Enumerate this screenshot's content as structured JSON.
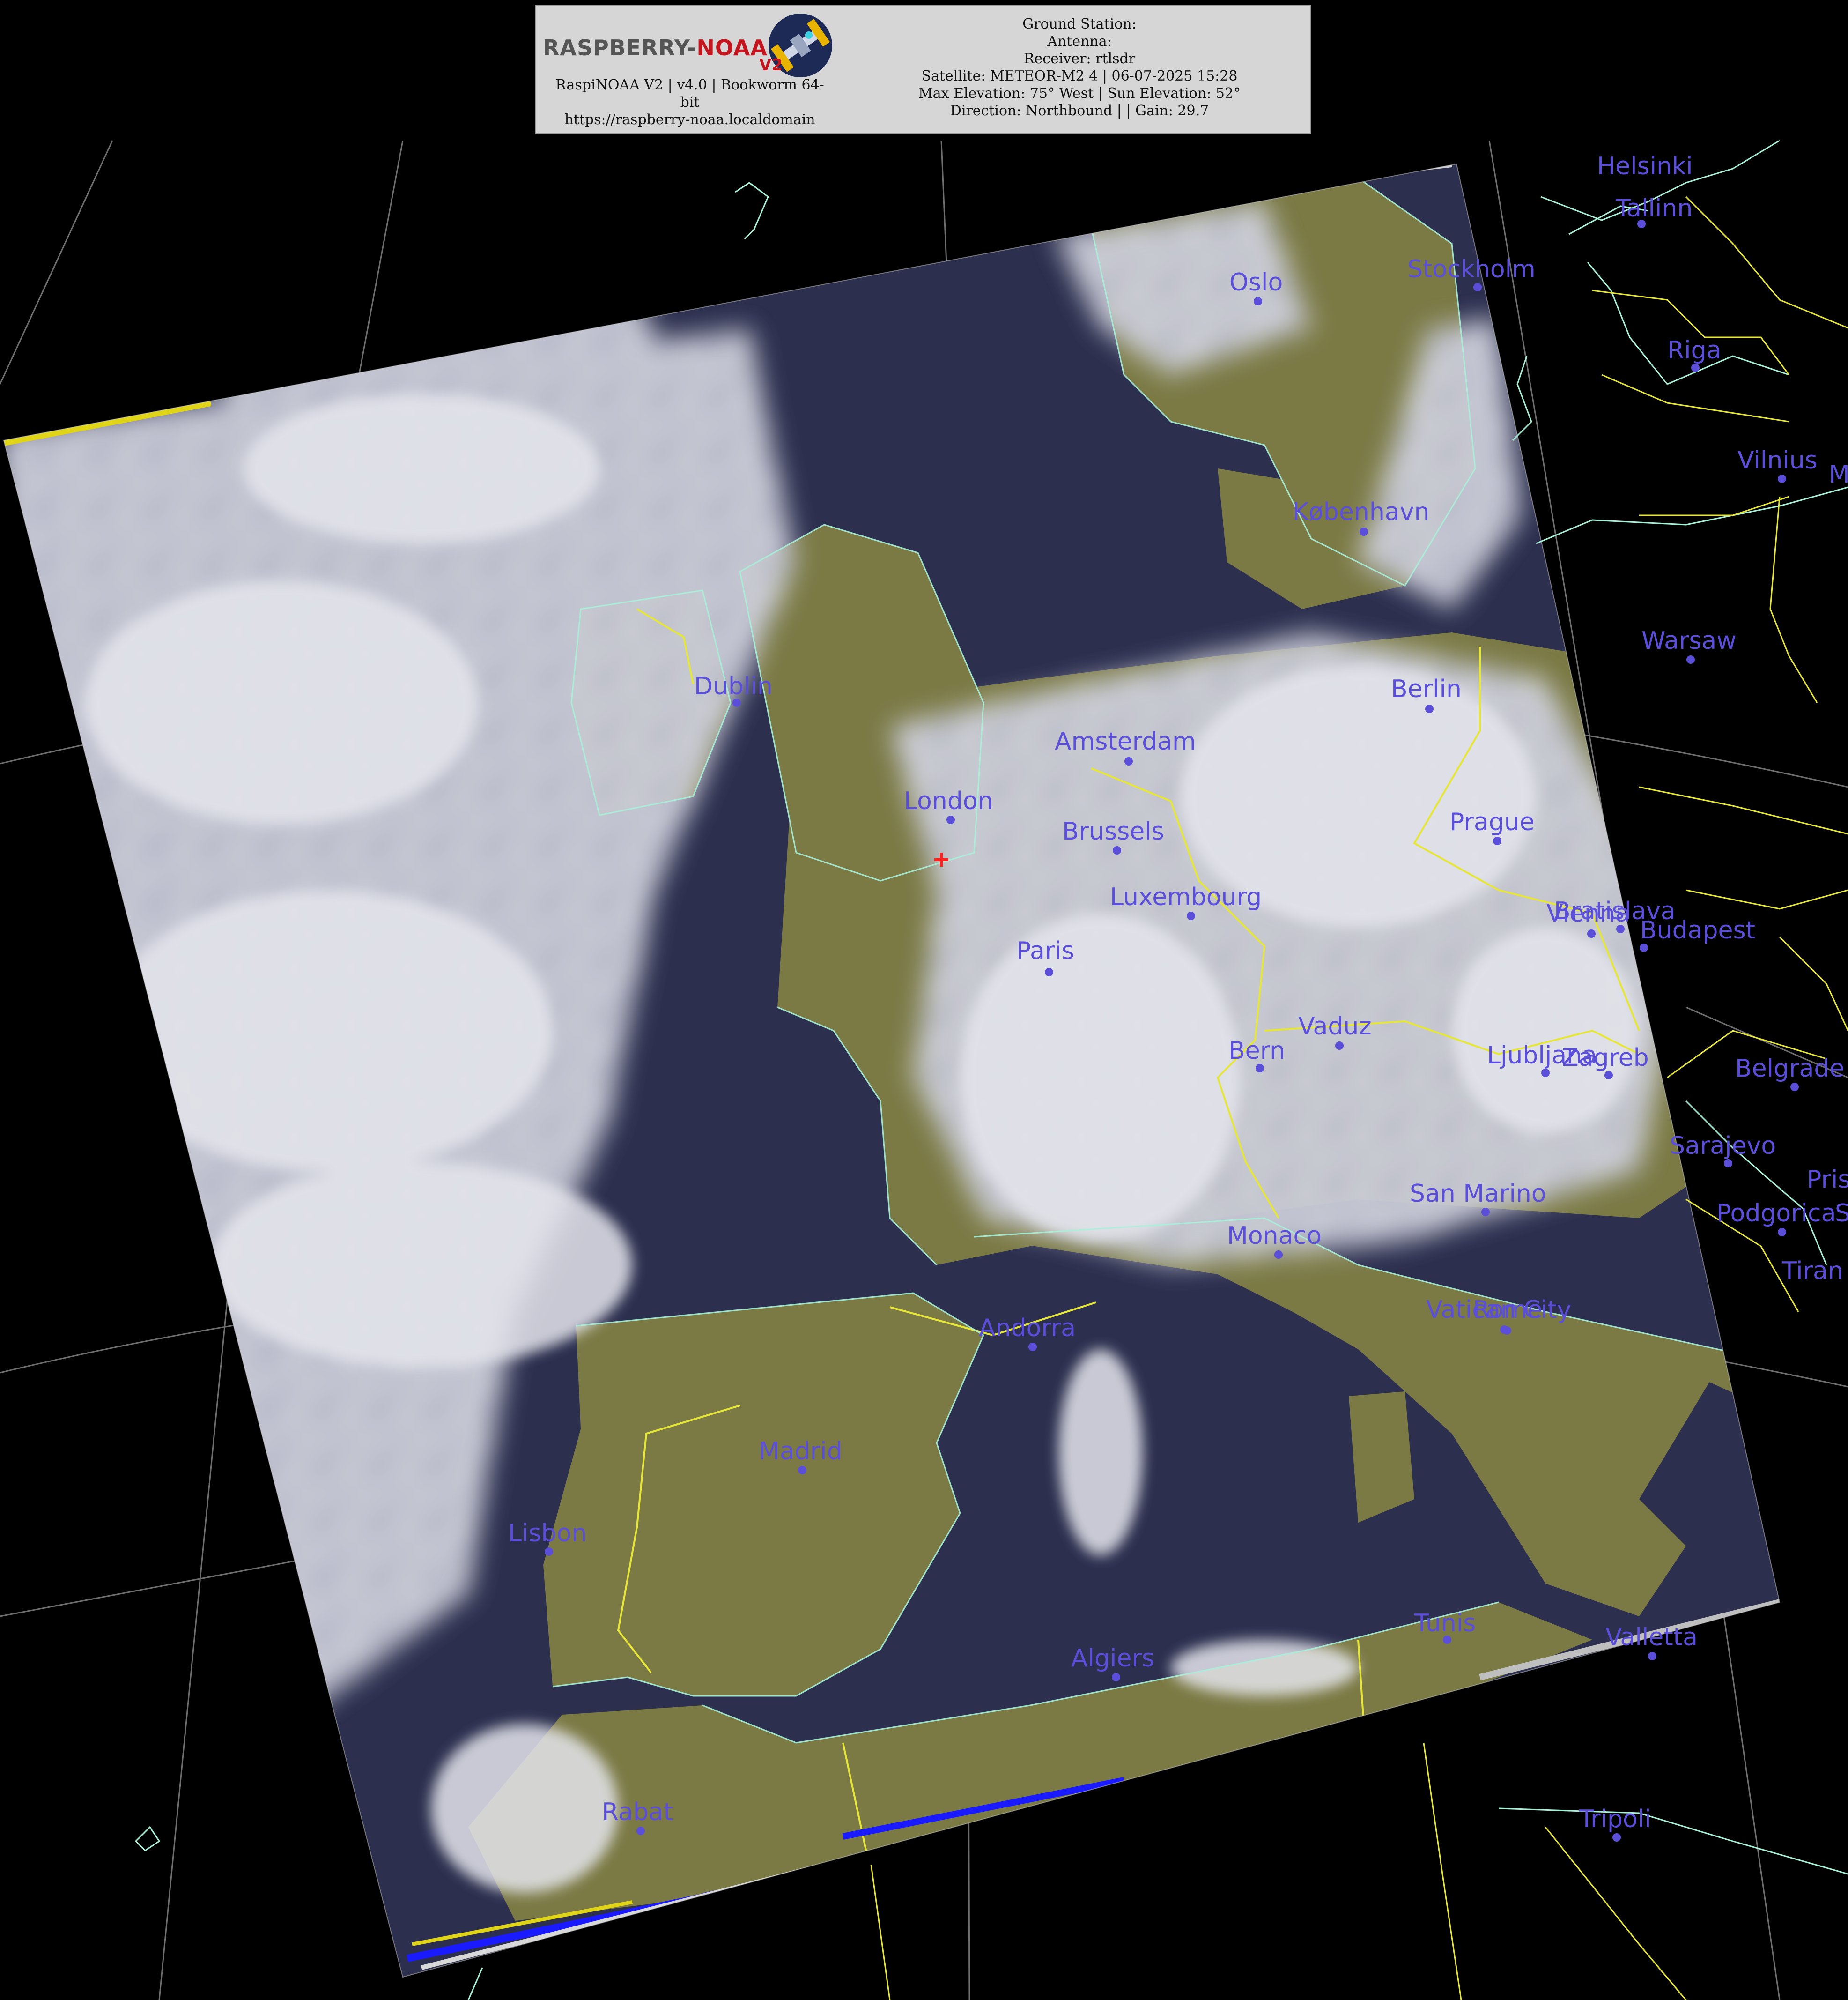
{
  "header": {
    "logo_text_main": "RASPBERRY-",
    "logo_text_accent": "NOAA",
    "logo_v2": "V2",
    "software_line1": "RaspiNOAA V2 | v4.0 | Bookworm 64-",
    "software_line2": "bit",
    "url": "https://raspberry-noaa.localdomain",
    "ground_station": "Ground Station:",
    "antenna": "Antenna:",
    "receiver": "Receiver: rtlsdr",
    "satellite": "Satellite: METEOR-M2 4 | 06-07-2025 15:28",
    "elevation": "Max Elevation: 75° West | Sun Elevation: 52°",
    "direction": "Direction: Northbound | | Gain: 29.7"
  },
  "colors": {
    "background": "#000000",
    "city_label": "#5b4fd9",
    "header_bg": "#d6d6d6",
    "border_line": "#e6e63a",
    "coast_line": "#a8f0d8",
    "graticule": "#777777",
    "cloud": "#e8e8ee",
    "land": "#7b7a45",
    "sea": "#2c2f4e",
    "strip_blue": "#1a1aff",
    "strip_yellow": "#e0d418",
    "station_marker": "#ff2020"
  },
  "cities": [
    {
      "name": "Helsinki"
    },
    {
      "name": "Tallinn"
    },
    {
      "name": "Oslo"
    },
    {
      "name": "Stockholm"
    },
    {
      "name": "Riga"
    },
    {
      "name": "Vilnius"
    },
    {
      "name": "M"
    },
    {
      "name": "København"
    },
    {
      "name": "Warsaw"
    },
    {
      "name": "Dublin"
    },
    {
      "name": "Berlin"
    },
    {
      "name": "Amsterdam"
    },
    {
      "name": "London"
    },
    {
      "name": "Prague"
    },
    {
      "name": "Brussels"
    },
    {
      "name": "Luxembourg"
    },
    {
      "name": "Vienna"
    },
    {
      "name": "Bratislava"
    },
    {
      "name": "Budapest"
    },
    {
      "name": "Paris"
    },
    {
      "name": "Vaduz"
    },
    {
      "name": "Bern"
    },
    {
      "name": "Ljubljana"
    },
    {
      "name": "Zagreb"
    },
    {
      "name": "Belgrade"
    },
    {
      "name": "Sarajevo"
    },
    {
      "name": "Pris"
    },
    {
      "name": "San Marino"
    },
    {
      "name": "Podgorica"
    },
    {
      "name": "S"
    },
    {
      "name": "Monaco"
    },
    {
      "name": "Tiran"
    },
    {
      "name": "Andorra"
    },
    {
      "name": "Vatican City"
    },
    {
      "name": "Rome"
    },
    {
      "name": "Madrid"
    },
    {
      "name": "Lisbon"
    },
    {
      "name": "Tunis"
    },
    {
      "name": "Valletta"
    },
    {
      "name": "Algiers"
    },
    {
      "name": "Rabat"
    },
    {
      "name": "Tripoli"
    }
  ]
}
